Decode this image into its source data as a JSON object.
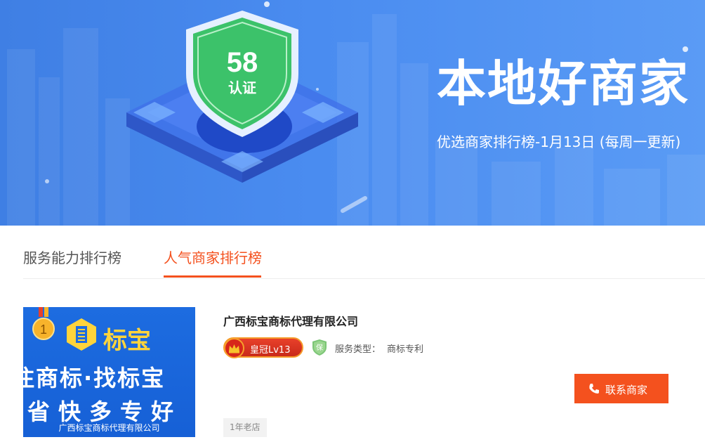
{
  "banner": {
    "badge_number": "58",
    "badge_text": "认证",
    "title": "本地好商家",
    "subtitle": "优选商家排行榜-1月13日 (每周一更新)"
  },
  "tabs": [
    {
      "label": "服务能力排行榜",
      "active": false
    },
    {
      "label": "人气商家排行榜",
      "active": true
    }
  ],
  "merchant": {
    "rank": "1",
    "thumbnail": {
      "logo_text": "标宝",
      "slogan_line1": "注商标·找标宝",
      "slogan_line2": "省快多专好",
      "company": "广西标宝商标代理有限公司"
    },
    "name": "广西标宝商标代理有限公司",
    "level_badge": "皇冠Lv13",
    "guarantee_icon": "bao-shield-icon",
    "service_type_label": "服务类型：",
    "service_type_value": "商标专利",
    "contact_button": "联系商家",
    "store_age": "1年老店"
  },
  "colors": {
    "accent": "#f4511e",
    "banner_blue": "#4a8cf0",
    "shield_green": "#3cc26a",
    "crown_red": "#d7261a",
    "thumb_blue": "#1d6ce0",
    "logo_yellow": "#ffd43b"
  }
}
